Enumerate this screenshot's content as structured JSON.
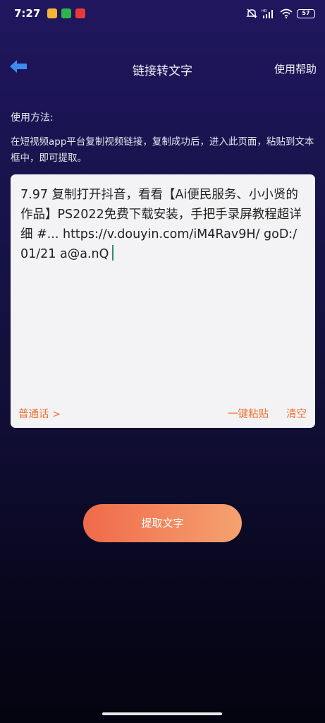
{
  "status_bar": {
    "time": "7:27",
    "battery": "57",
    "notification_colors": [
      "#f2b632",
      "#2fb44a",
      "#e8383a"
    ]
  },
  "header": {
    "title": "链接转文字",
    "help_label": "使用帮助",
    "back_icon": "arrow-left-icon",
    "back_icon_color": "#3d8bf0"
  },
  "instructions": {
    "title": "使用方法:",
    "description": "在短视频app平台复制视频链接，复制成功后，进入此页面，粘贴到文本框中，即可提取。"
  },
  "input": {
    "value": "7.97 复制打开抖音，看看【Ai便民服务、小小贤的作品】PS2022免费下载安装，手把手录屏教程超详细 #... https://v.douyin.com/iM4Rav9H/ goD:/ 01/21 a@a.nQ"
  },
  "card_actions": {
    "language_label": "普通话  >",
    "paste_label": "一键粘贴",
    "clear_label": "清空",
    "accent_color": "#ee7032"
  },
  "primary_action": {
    "label": "提取文字"
  }
}
